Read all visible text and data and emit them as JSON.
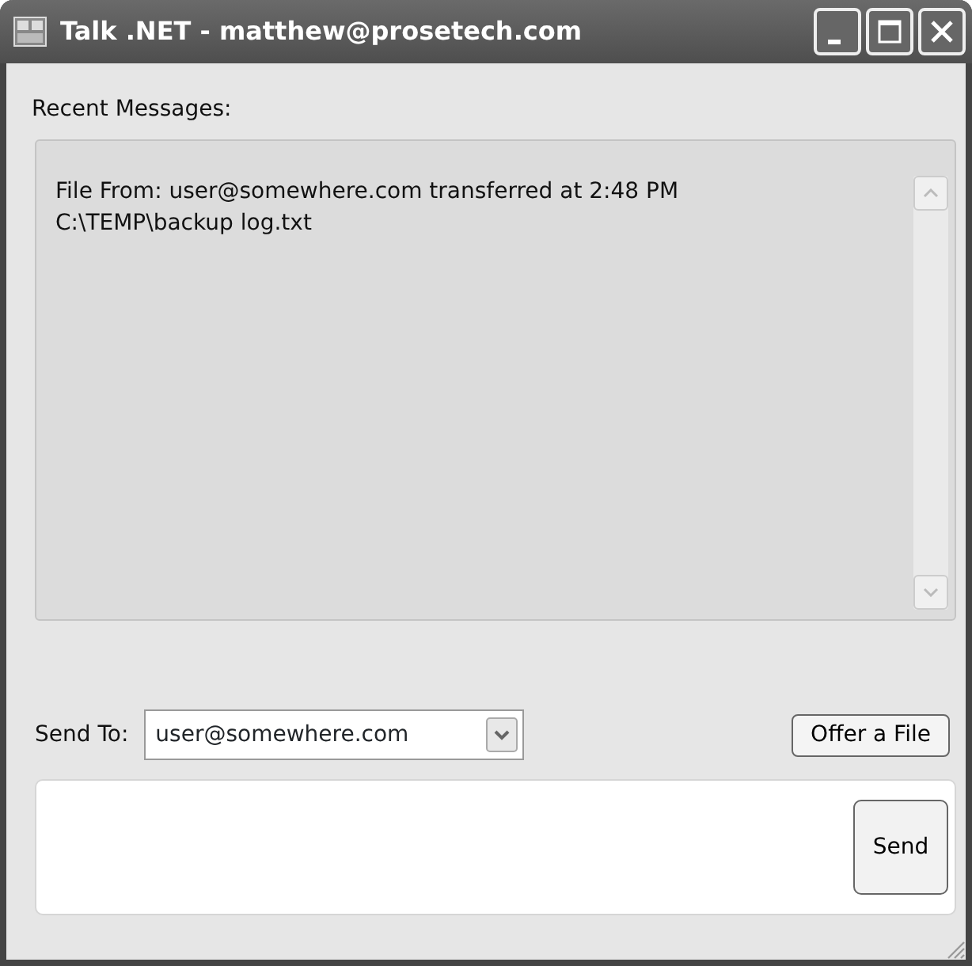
{
  "window": {
    "title": "Talk .NET - matthew@prosetech.com"
  },
  "recent_messages": {
    "label": "Recent Messages:",
    "lines": [
      "File From: user@somewhere.com transferred at 2:48 PM",
      "C:\\TEMP\\backup log.txt"
    ]
  },
  "send_to": {
    "label": "Send To:",
    "value": "user@somewhere.com"
  },
  "buttons": {
    "offer_file": "Offer a File",
    "send": "Send"
  }
}
